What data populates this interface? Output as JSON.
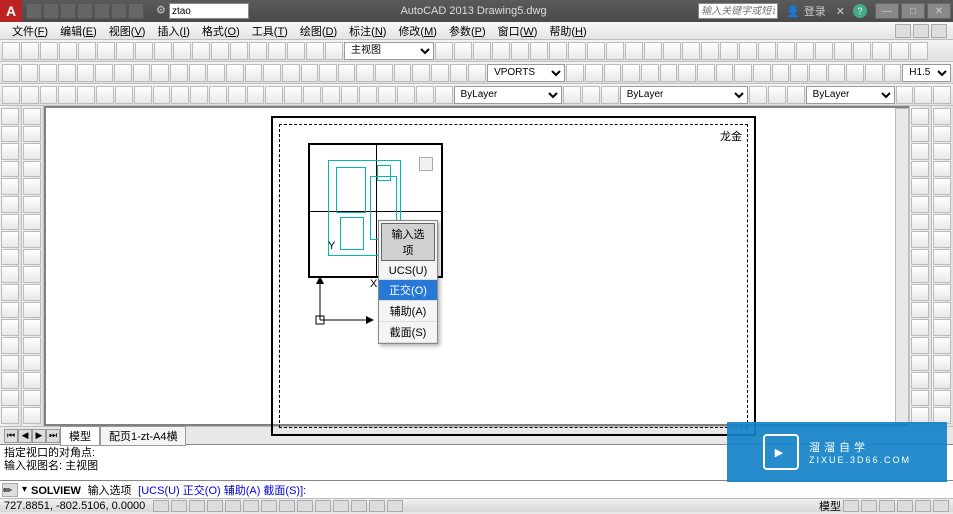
{
  "title": "AutoCAD 2013  Drawing5.dwg",
  "search_value": "ztao",
  "keyword_placeholder": "输入关键字或短语",
  "login_label": "登录",
  "menus": [
    {
      "label": "文件",
      "hot": "F"
    },
    {
      "label": "编辑",
      "hot": "E"
    },
    {
      "label": "视图",
      "hot": "V"
    },
    {
      "label": "插入",
      "hot": "I"
    },
    {
      "label": "格式",
      "hot": "O"
    },
    {
      "label": "工具",
      "hot": "T"
    },
    {
      "label": "绘图",
      "hot": "D"
    },
    {
      "label": "标注",
      "hot": "N"
    },
    {
      "label": "修改",
      "hot": "M"
    },
    {
      "label": "参数",
      "hot": "P"
    },
    {
      "label": "窗口",
      "hot": "W"
    },
    {
      "label": "帮助",
      "hot": "H"
    }
  ],
  "view_dropdown": "主视图",
  "vports_label": "VPORTS",
  "layer_label": "ByLayer",
  "lineweight": "ByLayer",
  "linescale": "H1.5",
  "color_label": "ByLayer",
  "popup": {
    "header": "输入选项",
    "items": [
      "UCS(U)",
      "正交(O)",
      "辅助(A)",
      "截面(S)"
    ],
    "selected": 1
  },
  "ucs": {
    "x": "X",
    "y": "Y"
  },
  "paper_mark": "龙金",
  "tabs": {
    "model": "模型",
    "layout": "配页1-zt-A4横"
  },
  "cmd_history": [
    "指定视口的对角点:",
    "输入视图名: 主视图"
  ],
  "cmd_prompt": {
    "cmd": "SOLVIEW",
    "label": "输入选项",
    "opts": "[UCS(U) 正交(O) 辅助(A) 截面(S)]:"
  },
  "status": {
    "coords": "727.8851, -802.5106, 0.0000",
    "mode": "模型"
  },
  "watermark": {
    "brand": "溜溜自学",
    "url": "ZIXUE.3D66.COM"
  }
}
